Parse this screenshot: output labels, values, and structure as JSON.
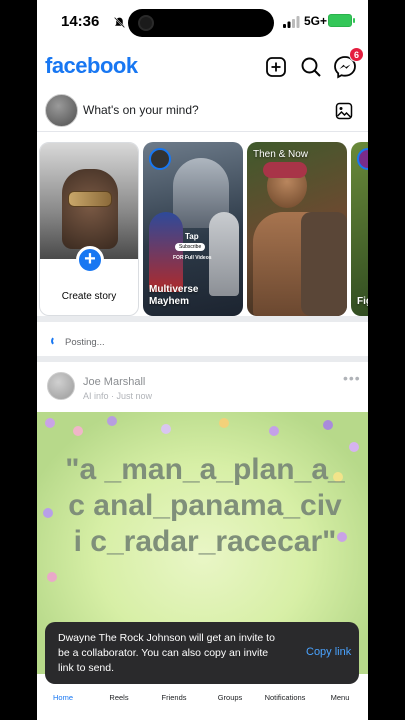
{
  "status_bar": {
    "time": "14:36",
    "network": "5G+"
  },
  "header": {
    "logo": "facebook",
    "messenger_badge": "6"
  },
  "composer": {
    "placeholder": "What's on your mind?"
  },
  "stories": [
    {
      "label": "Create story",
      "kind": "create"
    },
    {
      "label": "Multiverse Mayhem",
      "overlay_tap": "Tap",
      "overlay_subscribe": "Subscribe",
      "overlay_full": "FOR Full Videos"
    },
    {
      "label": "Then & Now"
    },
    {
      "label": "Figh"
    }
  ],
  "posting": {
    "text": "Posting..."
  },
  "post": {
    "author": "Joe Marshall",
    "meta": "AI info · Just now",
    "text": "\"a _man_a_plan_a_c anal_panama_civi c_radar_racecar\""
  },
  "toast": {
    "message": "Dwayne The Rock Johnson will get an invite to be a collaborator. You can also copy an invite link to send.",
    "action": "Copy link"
  },
  "bottom_nav": [
    {
      "label": "Home",
      "active": true
    },
    {
      "label": "Reels"
    },
    {
      "label": "Friends"
    },
    {
      "label": "Groups"
    },
    {
      "label": "Notifications"
    },
    {
      "label": "Menu"
    }
  ],
  "colors": {
    "brand": "#1877f2",
    "badge": "#e41e3f",
    "toast_bg": "#2a2a2c",
    "toast_link": "#4aa3ff"
  }
}
